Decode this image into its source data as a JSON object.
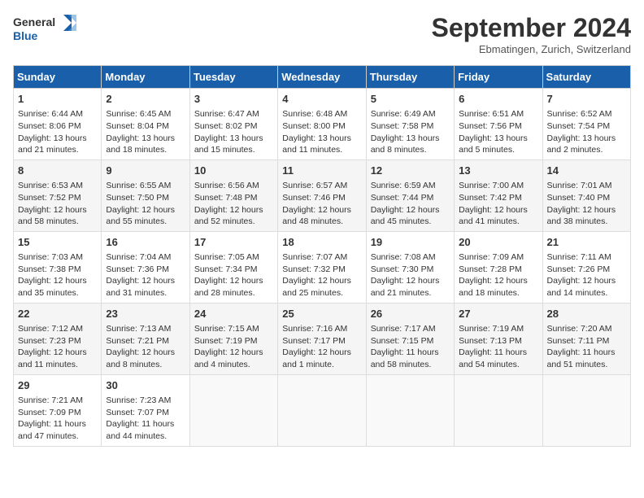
{
  "logo": {
    "line1": "General",
    "line2": "Blue"
  },
  "title": "September 2024",
  "location": "Ebmatingen, Zurich, Switzerland",
  "days_of_week": [
    "Sunday",
    "Monday",
    "Tuesday",
    "Wednesday",
    "Thursday",
    "Friday",
    "Saturday"
  ],
  "weeks": [
    [
      {
        "day": "1",
        "lines": [
          "Sunrise: 6:44 AM",
          "Sunset: 8:06 PM",
          "Daylight: 13 hours",
          "and 21 minutes."
        ]
      },
      {
        "day": "2",
        "lines": [
          "Sunrise: 6:45 AM",
          "Sunset: 8:04 PM",
          "Daylight: 13 hours",
          "and 18 minutes."
        ]
      },
      {
        "day": "3",
        "lines": [
          "Sunrise: 6:47 AM",
          "Sunset: 8:02 PM",
          "Daylight: 13 hours",
          "and 15 minutes."
        ]
      },
      {
        "day": "4",
        "lines": [
          "Sunrise: 6:48 AM",
          "Sunset: 8:00 PM",
          "Daylight: 13 hours",
          "and 11 minutes."
        ]
      },
      {
        "day": "5",
        "lines": [
          "Sunrise: 6:49 AM",
          "Sunset: 7:58 PM",
          "Daylight: 13 hours",
          "and 8 minutes."
        ]
      },
      {
        "day": "6",
        "lines": [
          "Sunrise: 6:51 AM",
          "Sunset: 7:56 PM",
          "Daylight: 13 hours",
          "and 5 minutes."
        ]
      },
      {
        "day": "7",
        "lines": [
          "Sunrise: 6:52 AM",
          "Sunset: 7:54 PM",
          "Daylight: 13 hours",
          "and 2 minutes."
        ]
      }
    ],
    [
      {
        "day": "8",
        "lines": [
          "Sunrise: 6:53 AM",
          "Sunset: 7:52 PM",
          "Daylight: 12 hours",
          "and 58 minutes."
        ]
      },
      {
        "day": "9",
        "lines": [
          "Sunrise: 6:55 AM",
          "Sunset: 7:50 PM",
          "Daylight: 12 hours",
          "and 55 minutes."
        ]
      },
      {
        "day": "10",
        "lines": [
          "Sunrise: 6:56 AM",
          "Sunset: 7:48 PM",
          "Daylight: 12 hours",
          "and 52 minutes."
        ]
      },
      {
        "day": "11",
        "lines": [
          "Sunrise: 6:57 AM",
          "Sunset: 7:46 PM",
          "Daylight: 12 hours",
          "and 48 minutes."
        ]
      },
      {
        "day": "12",
        "lines": [
          "Sunrise: 6:59 AM",
          "Sunset: 7:44 PM",
          "Daylight: 12 hours",
          "and 45 minutes."
        ]
      },
      {
        "day": "13",
        "lines": [
          "Sunrise: 7:00 AM",
          "Sunset: 7:42 PM",
          "Daylight: 12 hours",
          "and 41 minutes."
        ]
      },
      {
        "day": "14",
        "lines": [
          "Sunrise: 7:01 AM",
          "Sunset: 7:40 PM",
          "Daylight: 12 hours",
          "and 38 minutes."
        ]
      }
    ],
    [
      {
        "day": "15",
        "lines": [
          "Sunrise: 7:03 AM",
          "Sunset: 7:38 PM",
          "Daylight: 12 hours",
          "and 35 minutes."
        ]
      },
      {
        "day": "16",
        "lines": [
          "Sunrise: 7:04 AM",
          "Sunset: 7:36 PM",
          "Daylight: 12 hours",
          "and 31 minutes."
        ]
      },
      {
        "day": "17",
        "lines": [
          "Sunrise: 7:05 AM",
          "Sunset: 7:34 PM",
          "Daylight: 12 hours",
          "and 28 minutes."
        ]
      },
      {
        "day": "18",
        "lines": [
          "Sunrise: 7:07 AM",
          "Sunset: 7:32 PM",
          "Daylight: 12 hours",
          "and 25 minutes."
        ]
      },
      {
        "day": "19",
        "lines": [
          "Sunrise: 7:08 AM",
          "Sunset: 7:30 PM",
          "Daylight: 12 hours",
          "and 21 minutes."
        ]
      },
      {
        "day": "20",
        "lines": [
          "Sunrise: 7:09 AM",
          "Sunset: 7:28 PM",
          "Daylight: 12 hours",
          "and 18 minutes."
        ]
      },
      {
        "day": "21",
        "lines": [
          "Sunrise: 7:11 AM",
          "Sunset: 7:26 PM",
          "Daylight: 12 hours",
          "and 14 minutes."
        ]
      }
    ],
    [
      {
        "day": "22",
        "lines": [
          "Sunrise: 7:12 AM",
          "Sunset: 7:23 PM",
          "Daylight: 12 hours",
          "and 11 minutes."
        ]
      },
      {
        "day": "23",
        "lines": [
          "Sunrise: 7:13 AM",
          "Sunset: 7:21 PM",
          "Daylight: 12 hours",
          "and 8 minutes."
        ]
      },
      {
        "day": "24",
        "lines": [
          "Sunrise: 7:15 AM",
          "Sunset: 7:19 PM",
          "Daylight: 12 hours",
          "and 4 minutes."
        ]
      },
      {
        "day": "25",
        "lines": [
          "Sunrise: 7:16 AM",
          "Sunset: 7:17 PM",
          "Daylight: 12 hours",
          "and 1 minute."
        ]
      },
      {
        "day": "26",
        "lines": [
          "Sunrise: 7:17 AM",
          "Sunset: 7:15 PM",
          "Daylight: 11 hours",
          "and 58 minutes."
        ]
      },
      {
        "day": "27",
        "lines": [
          "Sunrise: 7:19 AM",
          "Sunset: 7:13 PM",
          "Daylight: 11 hours",
          "and 54 minutes."
        ]
      },
      {
        "day": "28",
        "lines": [
          "Sunrise: 7:20 AM",
          "Sunset: 7:11 PM",
          "Daylight: 11 hours",
          "and 51 minutes."
        ]
      }
    ],
    [
      {
        "day": "29",
        "lines": [
          "Sunrise: 7:21 AM",
          "Sunset: 7:09 PM",
          "Daylight: 11 hours",
          "and 47 minutes."
        ]
      },
      {
        "day": "30",
        "lines": [
          "Sunrise: 7:23 AM",
          "Sunset: 7:07 PM",
          "Daylight: 11 hours",
          "and 44 minutes."
        ]
      },
      {
        "day": "",
        "lines": []
      },
      {
        "day": "",
        "lines": []
      },
      {
        "day": "",
        "lines": []
      },
      {
        "day": "",
        "lines": []
      },
      {
        "day": "",
        "lines": []
      }
    ]
  ]
}
